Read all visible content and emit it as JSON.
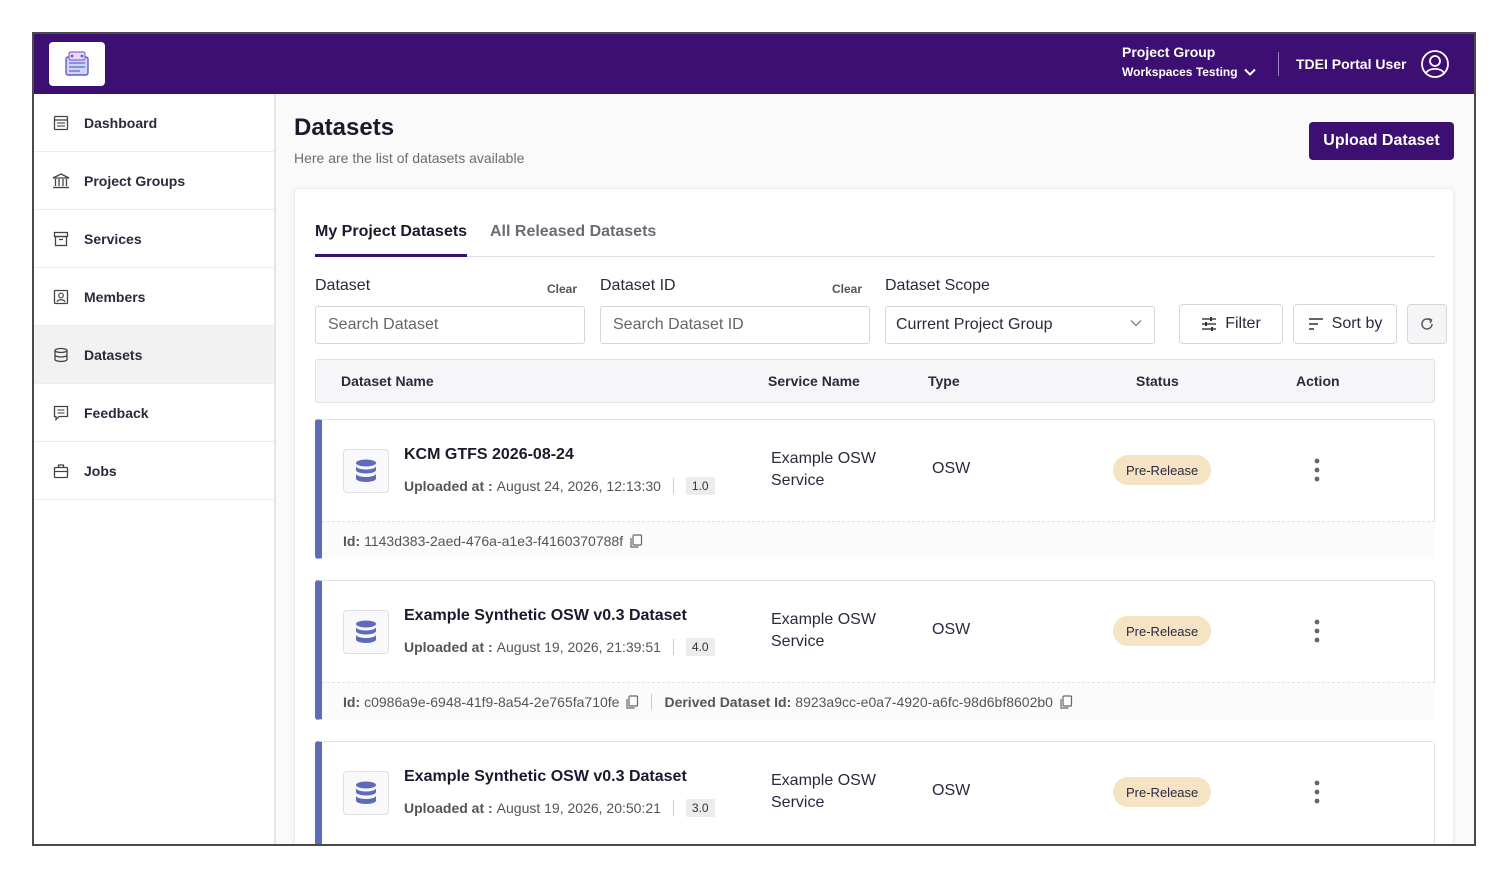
{
  "header": {
    "project_group_title": "Project Group",
    "project_group_name": "Workspaces Testing",
    "user_name": "TDEI Portal User"
  },
  "sidebar": {
    "items": [
      {
        "label": "Dashboard",
        "icon": "dashboard-icon"
      },
      {
        "label": "Project Groups",
        "icon": "bank-icon"
      },
      {
        "label": "Services",
        "icon": "archive-icon"
      },
      {
        "label": "Members",
        "icon": "member-icon"
      },
      {
        "label": "Datasets",
        "icon": "database-icon",
        "active": true
      },
      {
        "label": "Feedback",
        "icon": "feedback-icon"
      },
      {
        "label": "Jobs",
        "icon": "briefcase-icon"
      }
    ]
  },
  "page": {
    "title": "Datasets",
    "subtitle": "Here are the list of datasets available",
    "upload_label": "Upload Dataset"
  },
  "tabs": {
    "my": "My Project Datasets",
    "all": "All Released Datasets"
  },
  "filters": {
    "dataset_label": "Dataset",
    "dataset_clear": "Clear",
    "dataset_placeholder": "Search Dataset",
    "id_label": "Dataset ID",
    "id_clear": "Clear",
    "id_placeholder": "Search Dataset ID",
    "scope_label": "Dataset Scope",
    "scope_value": "Current Project Group",
    "filter_label": "Filter",
    "sort_label": "Sort by"
  },
  "table": {
    "headers": {
      "name": "Dataset Name",
      "service": "Service Name",
      "type": "Type",
      "status": "Status",
      "action": "Action"
    },
    "rows": [
      {
        "name": "KCM GTFS 2026-08-24",
        "uploaded_label": "Uploaded at :",
        "uploaded_at": "August 24, 2026, 12:13:30",
        "version": "1.0",
        "service_line1": "Example OSW",
        "service_line2": "Service",
        "type": "OSW",
        "status": "Pre-Release",
        "id_label": "Id:",
        "id": "1143d383-2aed-476a-a1e3-f4160370788f"
      },
      {
        "name": "Example Synthetic OSW v0.3 Dataset",
        "uploaded_label": "Uploaded at :",
        "uploaded_at": "August 19, 2026, 21:39:51",
        "version": "4.0",
        "service_line1": "Example OSW",
        "service_line2": "Service",
        "type": "OSW",
        "status": "Pre-Release",
        "id_label": "Id:",
        "id": "c0986a9e-6948-41f9-8a54-2e765fa710fe",
        "derived_label": "Derived Dataset Id:",
        "derived_id": "8923a9cc-e0a7-4920-a6fc-98d6bf8602b0"
      },
      {
        "name": "Example Synthetic OSW v0.3 Dataset",
        "uploaded_label": "Uploaded at :",
        "uploaded_at": "August 19, 2026, 20:50:21",
        "version": "3.0",
        "service_line1": "Example OSW",
        "service_line2": "Service",
        "type": "OSW",
        "status": "Pre-Release"
      }
    ]
  },
  "colors": {
    "brand": "#3d0f72",
    "row_accent": "#5d6bb8",
    "status_bg": "#f5e3c3"
  }
}
